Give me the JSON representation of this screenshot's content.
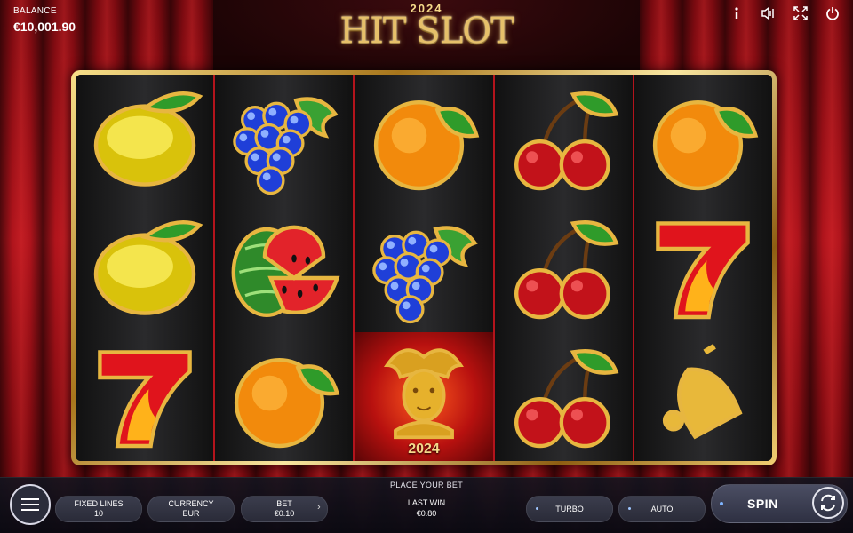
{
  "hud": {
    "balance_label": "BALANCE",
    "balance_value": "€10,001.90",
    "logo_year": "2024",
    "logo_title": "HIT SLOT",
    "icons": [
      "info-icon",
      "sound-icon",
      "fullscreen-icon",
      "power-icon"
    ]
  },
  "reels": [
    [
      "lemon",
      "lemon",
      "seven"
    ],
    [
      "grapes",
      "watermelon",
      "orange"
    ],
    [
      "orange",
      "grapes",
      "joker"
    ],
    [
      "cherries",
      "cherries",
      "cherries"
    ],
    [
      "orange",
      "seven",
      "bell"
    ]
  ],
  "joker_label": "2024",
  "controls": {
    "place_bet": "PLACE YOUR BET",
    "fixed_lines_label": "FIXED LINES",
    "fixed_lines_value": "10",
    "currency_label": "CURRENCY",
    "currency_value": "EUR",
    "bet_label": "BET",
    "bet_value": "€0.10",
    "last_win_label": "LAST WIN",
    "last_win_value": "€0.80",
    "turbo_label": "TURBO",
    "auto_label": "AUTO",
    "spin_label": "SPIN"
  },
  "colors": {
    "curtain": "#b0141c",
    "reel_divider": "#b3141c",
    "frame_gold": "#e6c06a"
  }
}
